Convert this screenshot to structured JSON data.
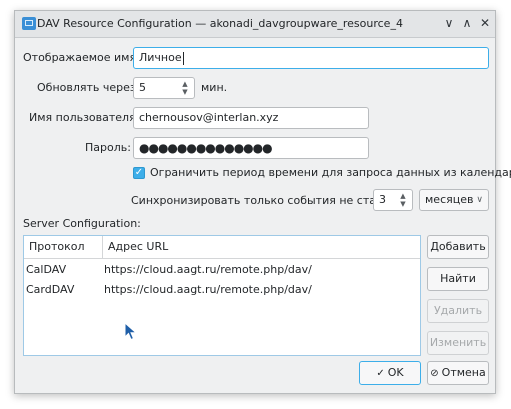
{
  "window": {
    "title": "DAV Resource Configuration — akonadi_davgroupware_resource_4"
  },
  "titlebar": {
    "minimize_glyph": "∨",
    "maximize_glyph": "∧",
    "close_glyph": "✕"
  },
  "form": {
    "display_name_label": "Отображаемое имя:",
    "display_name_value": "Личное",
    "refresh_label": "Обновлять через",
    "refresh_value": "5",
    "refresh_unit": "мин.",
    "username_label": "Имя пользователя:",
    "username_value": "chernousov@interlan.xyz",
    "password_label": "Пароль:",
    "password_value": "●●●●●●●●●●●●●●",
    "limit_checkbox_label": "Ограничить период времени для запроса данных из календаря",
    "limit_checked": true,
    "sync_label": "Синхронизировать только события не старше",
    "sync_value": "3",
    "sync_unit_selected": "месяцев"
  },
  "server": {
    "section_label": "Server Configuration:",
    "columns": [
      "Протокол",
      "Адрес URL"
    ],
    "rows": [
      {
        "protocol": "CalDAV",
        "url": "https://cloud.aagt.ru/remote.php/dav/"
      },
      {
        "protocol": "CardDAV",
        "url": "https://cloud.aagt.ru/remote.php/dav/"
      }
    ],
    "buttons": {
      "add": "Добавить",
      "find": "Найти",
      "remove": "Удалить",
      "edit": "Изменить"
    }
  },
  "dialog_buttons": {
    "ok": "OK",
    "cancel": "Отмена"
  },
  "colors": {
    "accent": "#3daee9",
    "window_bg": "#eff0f1"
  }
}
